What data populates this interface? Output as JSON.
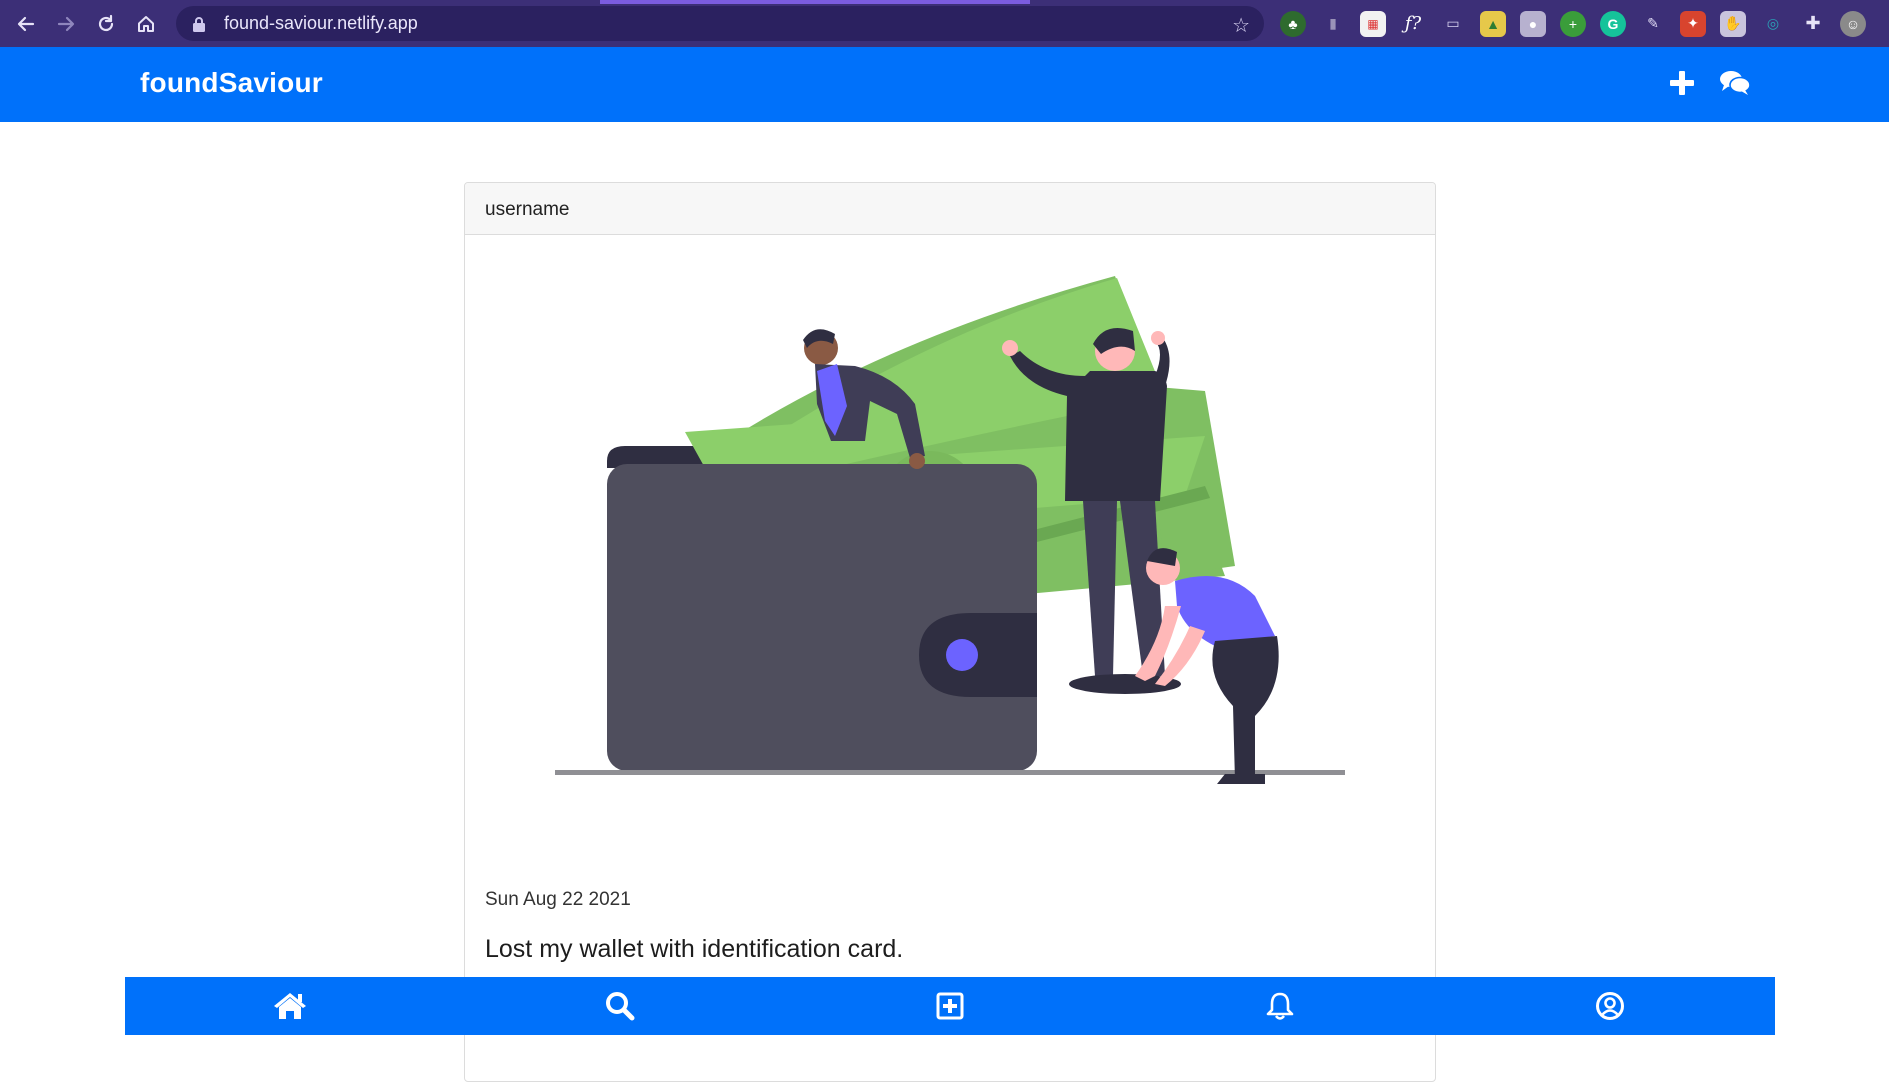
{
  "browser": {
    "url": "found-saviour.netlify.app"
  },
  "app": {
    "brand": "foundSaviour",
    "brand_color": "#0071fa"
  },
  "navbar": {
    "icons": [
      "plus-icon",
      "chat-bubbles-icon"
    ]
  },
  "post": {
    "username": "username",
    "date": "Sun Aug 22 2021",
    "title": "Lost my wallet with identification card.",
    "illustration": "wallet-with-money-illustration"
  },
  "bottom_nav": {
    "items": [
      "home-icon",
      "search-icon",
      "add-square-icon",
      "bell-icon",
      "user-circle-icon"
    ]
  }
}
